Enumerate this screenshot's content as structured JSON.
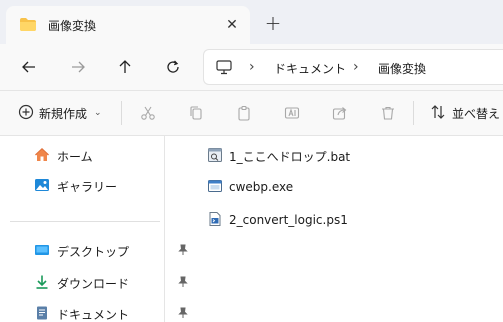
{
  "tab": {
    "title": "画像変換",
    "close_icon": "close-icon",
    "new_tab_icon": "plus-icon"
  },
  "nav": {
    "back_icon": "arrow-left-icon",
    "forward_icon": "arrow-right-icon",
    "up_icon": "arrow-up-icon",
    "refresh_icon": "refresh-icon"
  },
  "address": {
    "root_icon": "monitor-icon",
    "crumbs": [
      "ドキュメント",
      "画像変換"
    ]
  },
  "toolbar": {
    "new_label": "新規作成",
    "sort_label": "並べ替え",
    "icons": [
      "cut-icon",
      "copy-icon",
      "paste-icon",
      "rename-icon",
      "share-icon",
      "delete-icon"
    ]
  },
  "sidebar": {
    "items": [
      {
        "label": "ホーム",
        "icon": "home-icon",
        "pinned": false
      },
      {
        "label": "ギャラリー",
        "icon": "gallery-icon",
        "pinned": false
      },
      {
        "label": "デスクトップ",
        "icon": "desktop-icon",
        "pinned": true
      },
      {
        "label": "ダウンロード",
        "icon": "download-icon",
        "pinned": true
      },
      {
        "label": "ドキュメント",
        "icon": "documents-icon",
        "pinned": true
      }
    ]
  },
  "files": [
    {
      "name": "1_ここへドロップ.bat",
      "icon": "bat-file-icon"
    },
    {
      "name": "cwebp.exe",
      "icon": "exe-file-icon"
    },
    {
      "name": "2_convert_logic.ps1",
      "icon": "ps1-file-icon"
    }
  ],
  "colors": {
    "accent": "#0067c0",
    "folder": "#f8c24a",
    "tabstrip": "#eef0f5"
  }
}
